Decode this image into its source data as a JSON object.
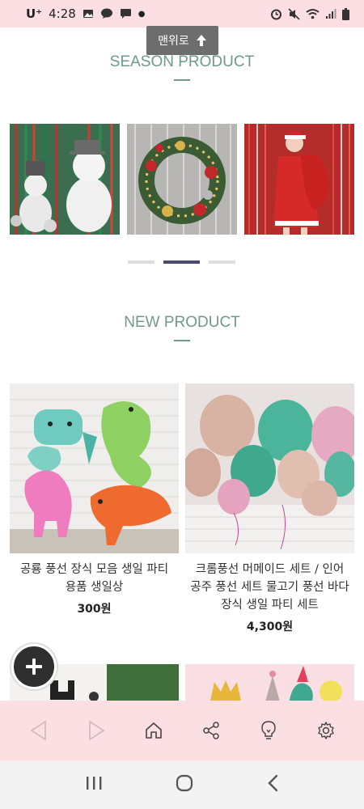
{
  "status_bar": {
    "carrier": "U⁺",
    "time": "4:28"
  },
  "top_button": {
    "label": "맨위로"
  },
  "season": {
    "title": "SEASON PRODUCT",
    "slides": [
      "snowman",
      "wreath",
      "santa"
    ],
    "active_page": 2,
    "page_count": 3
  },
  "new_product": {
    "title": "NEW PRODUCT",
    "items": [
      {
        "name_line1": "공룡 풍선 장식 모음 생일 파티",
        "name_line2": "용품 생일상",
        "price": "300원"
      },
      {
        "name_line1": "크롬풍선 머메이드 세트 / 인어",
        "name_line2": "공주 풍선 세트 물고기 풍선 바다",
        "name_line3": "장식 생일 파티 세트",
        "price": "4,300원"
      }
    ]
  },
  "toolbar": {
    "icons": [
      "back-icon",
      "forward-icon",
      "home-icon",
      "share-icon",
      "lightbulb-icon",
      "settings-icon"
    ]
  },
  "colors": {
    "accent": "#6f9a86",
    "pink_bar": "#fbdfe3",
    "pager_active": "#4a4a6a",
    "pager_inactive": "#dddddd"
  }
}
